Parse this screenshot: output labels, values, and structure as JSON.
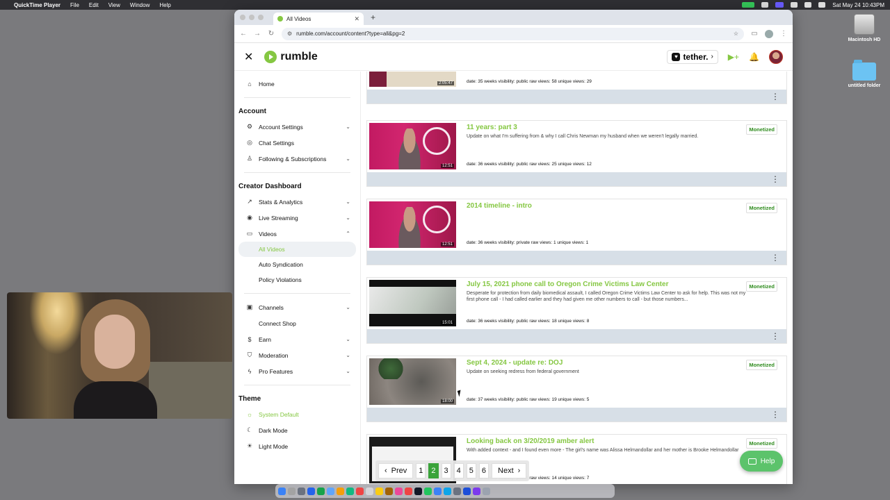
{
  "menubar": {
    "app": "QuickTime Player",
    "items": [
      "File",
      "Edit",
      "View",
      "Window",
      "Help"
    ],
    "datetime": "Sat May 24  10:43PM"
  },
  "desktop": {
    "hd_label": "Macintosh HD",
    "folder_label": "untitled folder"
  },
  "browser": {
    "tab_title": "All Videos",
    "url": "rumble.com/account/content?type=all&pg=2"
  },
  "header": {
    "logo_text": "rumble",
    "tether_text": "tether."
  },
  "sidebar": {
    "home": "Home",
    "account_heading": "Account",
    "account_items": [
      "Account Settings",
      "Chat Settings",
      "Following & Subscriptions"
    ],
    "creator_heading": "Creator Dashboard",
    "creator_items": [
      "Stats & Analytics",
      "Live Streaming",
      "Videos"
    ],
    "video_sub": [
      "All Videos",
      "Auto Syndication",
      "Policy Violations"
    ],
    "more_items": [
      "Channels",
      "Connect Shop",
      "Earn",
      "Moderation",
      "Pro Features"
    ],
    "theme_heading": "Theme",
    "theme_items": [
      "System Default",
      "Dark Mode",
      "Light Mode"
    ]
  },
  "videos": [
    {
      "title": "",
      "desc": "",
      "duration": "2:05:47",
      "meta": "date: 35 weeks   visibility: public   raw views: 58   unique views: 29",
      "badge": ""
    },
    {
      "title": "11 years: part 3",
      "desc": "Update on what I'm suffering from & why I call Chris Newman my husband when we weren't legally married.",
      "duration": "12:51",
      "meta": "date: 36 weeks   visibility: public   raw views: 25   unique views: 12",
      "badge": "Monetized"
    },
    {
      "title": "2014 timeline - intro",
      "desc": "",
      "duration": "12:51",
      "meta": "date: 36 weeks   visibility: private   raw views: 1   unique views: 1",
      "badge": "Monetized"
    },
    {
      "title": "July 15, 2021 phone call to Oregon Crime Victims Law Center",
      "desc": "Desperate for protection from daily biomedical assault, I called Oregon Crime Victims Law Center to ask for help. This was not my first phone call - I had called earlier and they had given me other numbers to call - but those numbers...",
      "duration": "15:01",
      "meta": "date: 36 weeks   visibility: public   raw views: 18   unique views: 8",
      "badge": "Monetized"
    },
    {
      "title": "Sept 4, 2024 - update re: DOJ",
      "desc": "Update on seeking redress from federal government",
      "duration": "18:00",
      "meta": "date: 37 weeks   visibility: public   raw views: 19   unique views: 5",
      "badge": "Monetized"
    },
    {
      "title": "Looking back on 3/20/2019 amber alert",
      "desc": "With added context - and I found even more - The girl's name was Alissa Helmandollar and her mother is Brooke Helmandollar",
      "duration": "",
      "meta": "date: 36 weeks   visibility: public   raw views: 14   unique views: 7",
      "badge": "Monetized"
    }
  ],
  "pagination": {
    "prev": "Prev",
    "next": "Next",
    "pages": [
      "1",
      "2",
      "3",
      "4",
      "5",
      "6"
    ],
    "current": "2"
  },
  "help_label": "Help"
}
